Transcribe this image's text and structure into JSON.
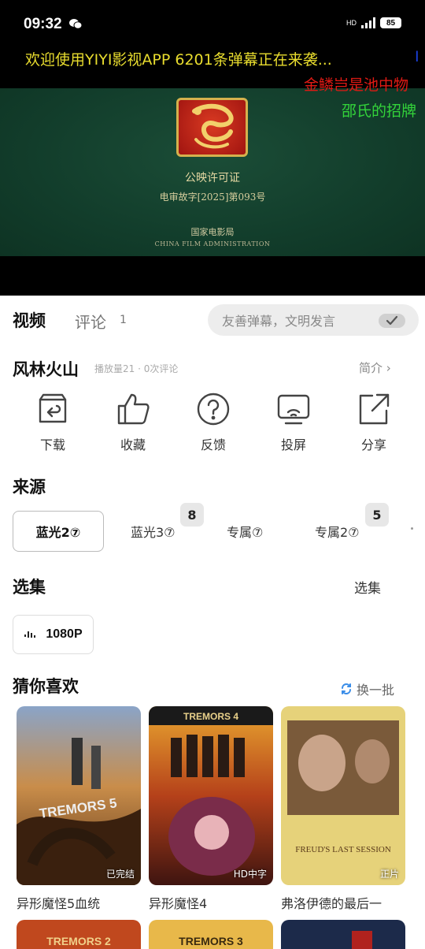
{
  "status_bar": {
    "time": "09:32",
    "network": "HD",
    "battery": "85"
  },
  "danmaku": [
    "欢迎使用YIYI影视APP 6201条弹幕正在来袭...",
    "I",
    "金鳞岂是池中物",
    "邵氏的招牌"
  ],
  "player": {
    "cert_title": "公映许可证",
    "cert_number": "电审故字[2025]第093号",
    "agency": "国家电影局",
    "agency_en": "CHINA FILM ADMINISTRATION"
  },
  "tabs": {
    "video": "视频",
    "comment": "评论",
    "comment_count": "1"
  },
  "danmaku_input": {
    "placeholder": "友善弹幕，文明发言"
  },
  "movie": {
    "title": "风林火山",
    "meta": "播放量21 · 0次评论",
    "brief": "简介 ›"
  },
  "actions": [
    {
      "label": "下载",
      "icon": "download-icon"
    },
    {
      "label": "收藏",
      "icon": "thumb-up-icon"
    },
    {
      "label": "反馈",
      "icon": "question-icon"
    },
    {
      "label": "投屏",
      "icon": "cast-icon"
    },
    {
      "label": "分享",
      "icon": "share-icon"
    }
  ],
  "source": {
    "title": "来源",
    "items": [
      {
        "label": "蓝光2⑦",
        "badge": ""
      },
      {
        "label": "蓝光3⑦",
        "badge": "8"
      },
      {
        "label": "专属⑦",
        "badge": ""
      },
      {
        "label": "专属2⑦",
        "badge": "5"
      }
    ]
  },
  "episodes": {
    "title": "选集",
    "link": "选集",
    "items": [
      "1080P"
    ]
  },
  "recommend": {
    "title": "猜你喜欢",
    "refresh": "换一批",
    "items": [
      {
        "name": "异形魔怪5血统",
        "tag": "已完结",
        "poster_text": "TREMORS 5"
      },
      {
        "name": "异形魔怪4",
        "tag": "HD中字",
        "poster_text": "TREMORS 4"
      },
      {
        "name": "弗洛伊德的最后一",
        "tag": "正片",
        "poster_text": "FREUD'S LAST SESSION"
      }
    ],
    "row2": [
      "TREMORS 2",
      "TREMORS 3",
      ""
    ]
  },
  "colors": {
    "danmaku_yellow": "#e8dc2e",
    "danmaku_red": "#e01a14",
    "danmaku_green": "#33d43a",
    "danmaku_blue": "#1a3fd8"
  }
}
